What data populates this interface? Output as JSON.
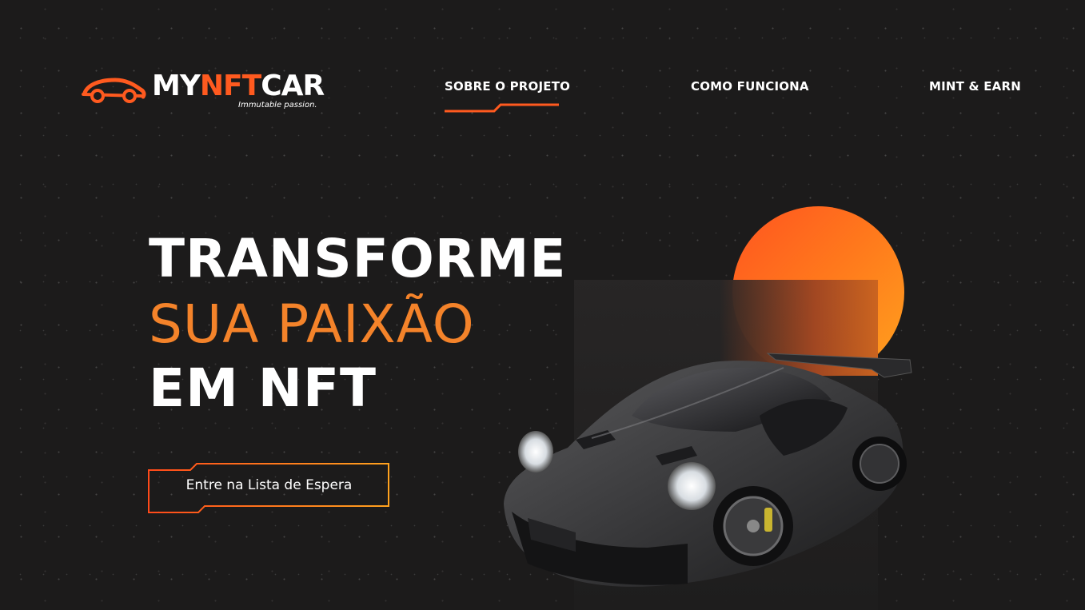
{
  "brand": {
    "name_part1": "MY",
    "name_part2": "NFT",
    "name_part3": "CAR",
    "tagline": "Immutable passion.",
    "accent_color": "#ff5a1f",
    "logo_icon": "car-outline-icon"
  },
  "nav": {
    "items": [
      {
        "label": "SOBRE O PROJETO",
        "active": true
      },
      {
        "label": "COMO FUNCIONA",
        "active": false
      },
      {
        "label": "MINT & EARN",
        "active": false
      }
    ]
  },
  "hero": {
    "line1": "TRANSFORME",
    "line2": "SUA PAIXÃO",
    "line3": "EM NFT",
    "cta_label": "Entre na Lista de Espera",
    "highlight_color": "#f4832a"
  },
  "colors": {
    "background": "#1c1b1b",
    "orange_start": "#ff5420",
    "orange_end": "#ffa21e"
  }
}
